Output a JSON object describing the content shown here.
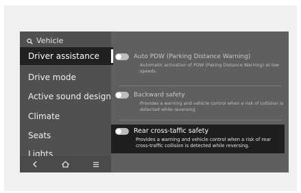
{
  "search": {
    "label": "Vehicle"
  },
  "sidebar": {
    "items": [
      {
        "label": "Driver assistance"
      },
      {
        "label": "Drive mode"
      },
      {
        "label": "Active sound design"
      },
      {
        "label": "Climate"
      },
      {
        "label": "Seats"
      },
      {
        "label": "Lights"
      }
    ]
  },
  "nav": {
    "back": "<",
    "home": "home-icon",
    "menu": "menu-icon"
  },
  "settings": [
    {
      "title": "Auto PDW (Parking Distance Warning)",
      "desc": "Automatic activation of PDW (Paking Distance Warning) at low speeds."
    },
    {
      "title": "Backward safety",
      "desc": "Provides a warning and vehicle control when a risk of collision is detected while reversing."
    },
    {
      "title": "Rear cross-taffic safety",
      "desc": "Provides a warning and vehicle control when a risk of rear cross-traffic collision is detected while reversing."
    }
  ]
}
